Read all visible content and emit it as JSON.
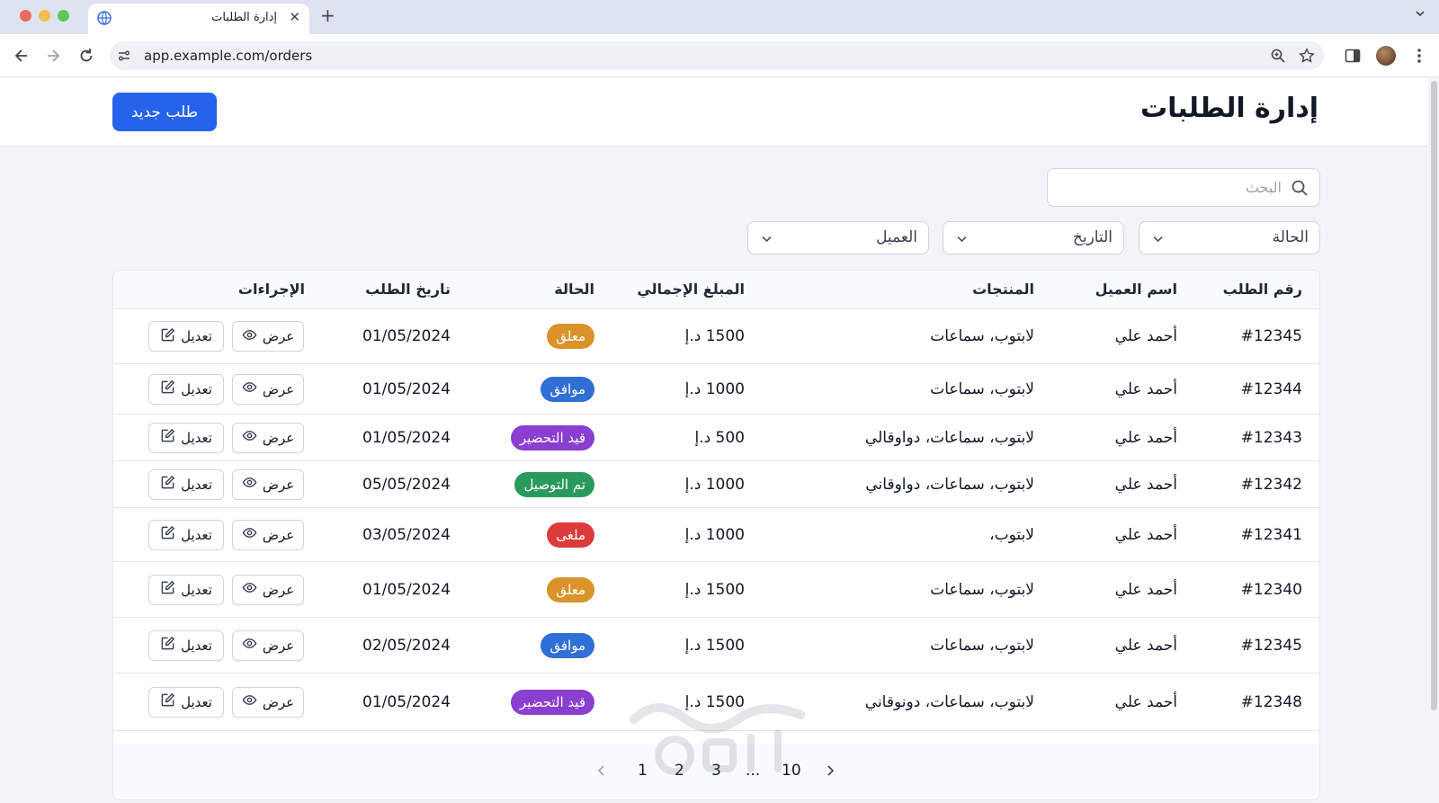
{
  "browser": {
    "tab_title": "إدارة الطلبات",
    "tab_close": "✕",
    "new_tab": "+",
    "url": "app.example.com/orders"
  },
  "header": {
    "title": "إدارة الطلبات",
    "new_order_label": "طلب جديد"
  },
  "search": {
    "placeholder": "البحث"
  },
  "filters": {
    "status": "الحالة",
    "date": "التاريخ",
    "customer": "العميل"
  },
  "table": {
    "columns": {
      "order_id": "رقم الطلب",
      "customer": "اسم العميل",
      "products": "المنتجات",
      "total": "المبلغ الإجمالي",
      "status": "الحالة",
      "date": "تاريخ الطلب",
      "actions": "الإجراءات"
    },
    "rows": [
      {
        "id": "#12345",
        "customer": "أحمد علي",
        "products": "لابتوب، سماعات",
        "total": "1500 د.إ",
        "status": "معلق",
        "status_color": "#d99329",
        "date": "01/05/2024"
      },
      {
        "id": "#12344",
        "customer": "أحمد علي",
        "products": "لابتوب، سماعات",
        "total": "1000 د.إ",
        "status": "موافق",
        "status_color": "#2f6fd6",
        "date": "01/05/2024"
      },
      {
        "id": "#12343",
        "customer": "أحمد علي",
        "products": "لابتوب، سماعات، دواوقالي",
        "total": "500 د.إ",
        "status": "قيد التحضير",
        "status_color": "#8a3fd1",
        "date": "01/05/2024"
      },
      {
        "id": "#12342",
        "customer": "أحمد علي",
        "products": "لابتوب، سماعات، دواوقاني",
        "total": "1000 د.إ",
        "status": "تم التوصيل",
        "status_color": "#2a9a5c",
        "date": "05/05/2024"
      },
      {
        "id": "#12341",
        "customer": "أحمد علي",
        "products": "لابتوب،",
        "total": "1000 د.إ",
        "status": "ملغى",
        "status_color": "#dc3b3b",
        "date": "03/05/2024"
      },
      {
        "id": "#12340",
        "customer": "أحمد علي",
        "products": "لابتوب، سماعات",
        "total": "1500 د.إ",
        "status": "معلق",
        "status_color": "#d99329",
        "date": "01/05/2024"
      },
      {
        "id": "#12345",
        "customer": "أحمد علي",
        "products": "لابتوب، سماعات",
        "total": "1500 د.إ",
        "status": "موافق",
        "status_color": "#2f6fd6",
        "date": "02/05/2024"
      },
      {
        "id": "#12348",
        "customer": "أحمد علي",
        "products": "لابتوب، سماعات، دونوقاني",
        "total": "1500 د.إ",
        "status": "قيد التحضير",
        "status_color": "#8a3fd1",
        "date": "01/05/2024"
      }
    ],
    "view_label": "عرض",
    "edit_label": "تعديل"
  },
  "pagination": {
    "pages": [
      "1",
      "2",
      "3",
      "...",
      "10"
    ]
  },
  "colors": {
    "primary": "#2563eb"
  }
}
